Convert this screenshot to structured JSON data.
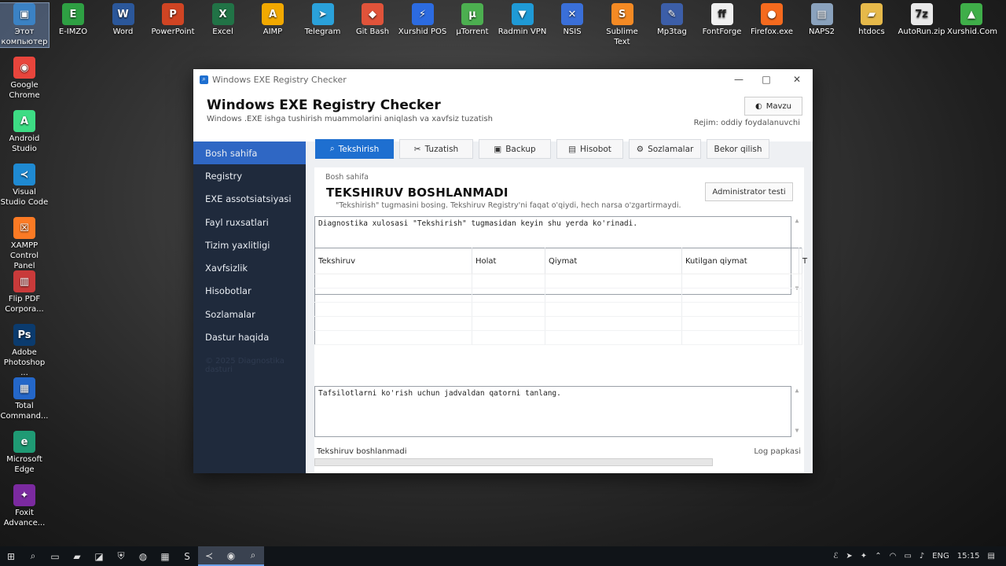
{
  "desktop": {
    "top_icons": [
      {
        "label": "Этот компьютер",
        "glyph": "▣",
        "color": "#3b82c4"
      },
      {
        "label": "E-IMZO",
        "glyph": "E",
        "color": "#2ea043"
      },
      {
        "label": "Word",
        "glyph": "W",
        "color": "#2b579a"
      },
      {
        "label": "PowerPoint",
        "glyph": "P",
        "color": "#d04423"
      },
      {
        "label": "Excel",
        "glyph": "X",
        "color": "#217346"
      },
      {
        "label": "AIMP",
        "glyph": "A",
        "color": "#f2a900"
      },
      {
        "label": "Telegram",
        "glyph": "➤",
        "color": "#2aa1da"
      },
      {
        "label": "Git Bash",
        "glyph": "◆",
        "color": "#e0533a"
      },
      {
        "label": "Xurshid POS",
        "glyph": "⚡",
        "color": "#2c6be0"
      },
      {
        "label": "µTorrent",
        "glyph": "µ",
        "color": "#4caf50"
      },
      {
        "label": "Radmin VPN",
        "glyph": "▼",
        "color": "#1f9ad6"
      },
      {
        "label": "NSIS",
        "glyph": "✕",
        "color": "#3a6fd8"
      },
      {
        "label": "Sublime Text",
        "glyph": "S",
        "color": "#f48a24"
      },
      {
        "label": "Mp3tag",
        "glyph": "✎",
        "color": "#3c5ea8"
      },
      {
        "label": "FontForge",
        "glyph": "ff",
        "color": "#f0f0f0"
      },
      {
        "label": "Firefox.exe",
        "glyph": "●",
        "color": "#f56a1e"
      },
      {
        "label": "NAPS2",
        "glyph": "▤",
        "color": "#8aa2bd"
      },
      {
        "label": "htdocs",
        "glyph": "▰",
        "color": "#e6b94a"
      },
      {
        "label": "AutoRun.zip",
        "glyph": "7z",
        "color": "#e9e9e9"
      },
      {
        "label": "Xurshid.Com",
        "glyph": "▲",
        "color": "#3fae49"
      }
    ],
    "left_icons": [
      {
        "label": "Google Chrome",
        "glyph": "◉",
        "color": "#e8453c"
      },
      {
        "label": "Android Studio",
        "glyph": "A",
        "color": "#3ddc84"
      },
      {
        "label": "Visual Studio Code",
        "glyph": "≺",
        "color": "#1f8ad2"
      },
      {
        "label": "XAMPP Control Panel",
        "glyph": "☒",
        "color": "#fb7a24"
      },
      {
        "label": "Flip PDF Corpora...",
        "glyph": "▥",
        "color": "#c93a3a"
      },
      {
        "label": "Adobe Photoshop ...",
        "glyph": "Ps",
        "color": "#0b3b6e"
      },
      {
        "label": "Total Command...",
        "glyph": "▦",
        "color": "#2467c9"
      },
      {
        "label": "Microsoft Edge",
        "glyph": "e",
        "color": "#1f9a74"
      },
      {
        "label": "Foxit Advance...",
        "glyph": "✦",
        "color": "#7b2aa0"
      }
    ]
  },
  "window": {
    "titlebar_text": "Windows EXE Registry Checker",
    "title": "Windows EXE Registry Checker",
    "subtitle": "Windows .EXE ishga tushirish muammolarini aniqlash va xavfsiz tuzatish",
    "theme_button": "Mavzu",
    "mode_text": "Rejim: oddiy foydalanuvchi",
    "sidebar": {
      "items": [
        "Bosh sahifa",
        "Registry",
        "EXE assotsiatsiyasi",
        "Fayl ruxsatlari",
        "Tizim yaxlitligi",
        "Xavfsizlik",
        "Hisobotlar",
        "Sozlamalar",
        "Dastur haqida"
      ],
      "active_index": 0,
      "footer": "© 2025 Diagnostika dasturi"
    },
    "toolbar": {
      "check": "Tekshirish",
      "fix": "Tuzatish",
      "backup": "Backup",
      "report": "Hisobot",
      "settings": "Sozlamalar",
      "cancel": "Bekor qilish"
    },
    "panel": {
      "breadcrumb": "Bosh sahifa",
      "status_title": "TEKSHIRUV BOSHLANMADI",
      "hint": "\"Tekshirish\" tugmasini bosing. Tekshiruv Registry'ni faqat o'qiydi, hech narsa o'zgartirmaydi.",
      "admin_button": "Administrator testi",
      "summary_text": "Diagnostika xulosasi \"Tekshirish\" tugmasidan keyin shu yerda ko'rinadi.",
      "table_headers": [
        "Tekshiruv",
        "Holat",
        "Qiymat",
        "Kutilgan qiymat",
        "T"
      ],
      "details_text": "Tafsilotlarni ko'rish uchun jadvaldan qatorni tanlang.",
      "bottom_status": "Tekshiruv boshlanmadi",
      "log_link": "Log papkasi",
      "progress": 0
    }
  },
  "taskbar": {
    "language": "ENG",
    "time": "15:15"
  }
}
